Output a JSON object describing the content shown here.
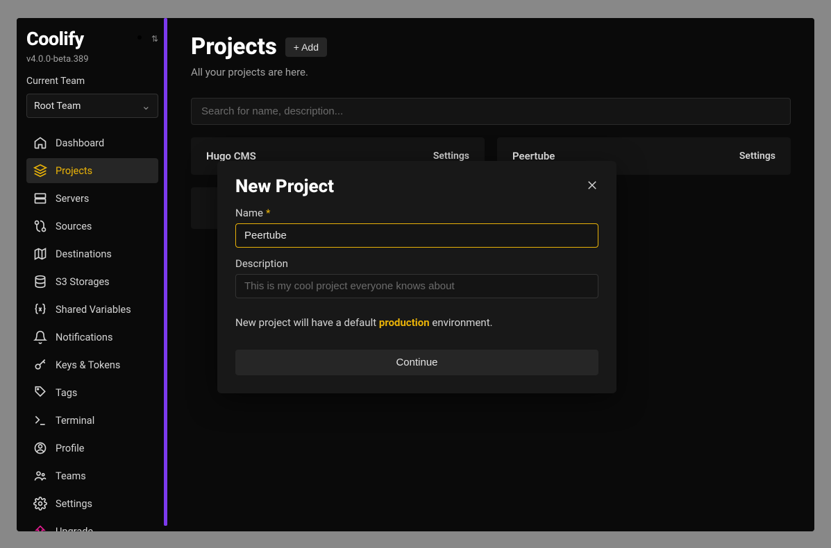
{
  "brand": {
    "name": "Coolify",
    "version": "v4.0.0-beta.389"
  },
  "team": {
    "label": "Current Team",
    "selected": "Root Team"
  },
  "nav": {
    "dashboard": "Dashboard",
    "projects": "Projects",
    "servers": "Servers",
    "sources": "Sources",
    "destinations": "Destinations",
    "s3storages": "S3 Storages",
    "sharedvars": "Shared Variables",
    "notifications": "Notifications",
    "keystokens": "Keys & Tokens",
    "tags": "Tags",
    "terminal": "Terminal",
    "profile": "Profile",
    "teams": "Teams",
    "settings": "Settings",
    "upgrade": "Upgrade"
  },
  "page": {
    "title": "Projects",
    "add_btn": "+ Add",
    "subtitle": "All your projects are here.",
    "search_placeholder": "Search for name, description..."
  },
  "projects": [
    {
      "name": "Hugo CMS",
      "settings_label": "Settings"
    },
    {
      "name": "Peertube",
      "settings_label": "Settings"
    }
  ],
  "modal": {
    "title": "New Project",
    "name_label": "Name",
    "name_value": "Peertube",
    "desc_label": "Description",
    "desc_placeholder": "This is my cool project everyone knows about",
    "hint_pre": "New project will have a default ",
    "hint_prod": "production",
    "hint_post": " environment.",
    "continue": "Continue"
  }
}
